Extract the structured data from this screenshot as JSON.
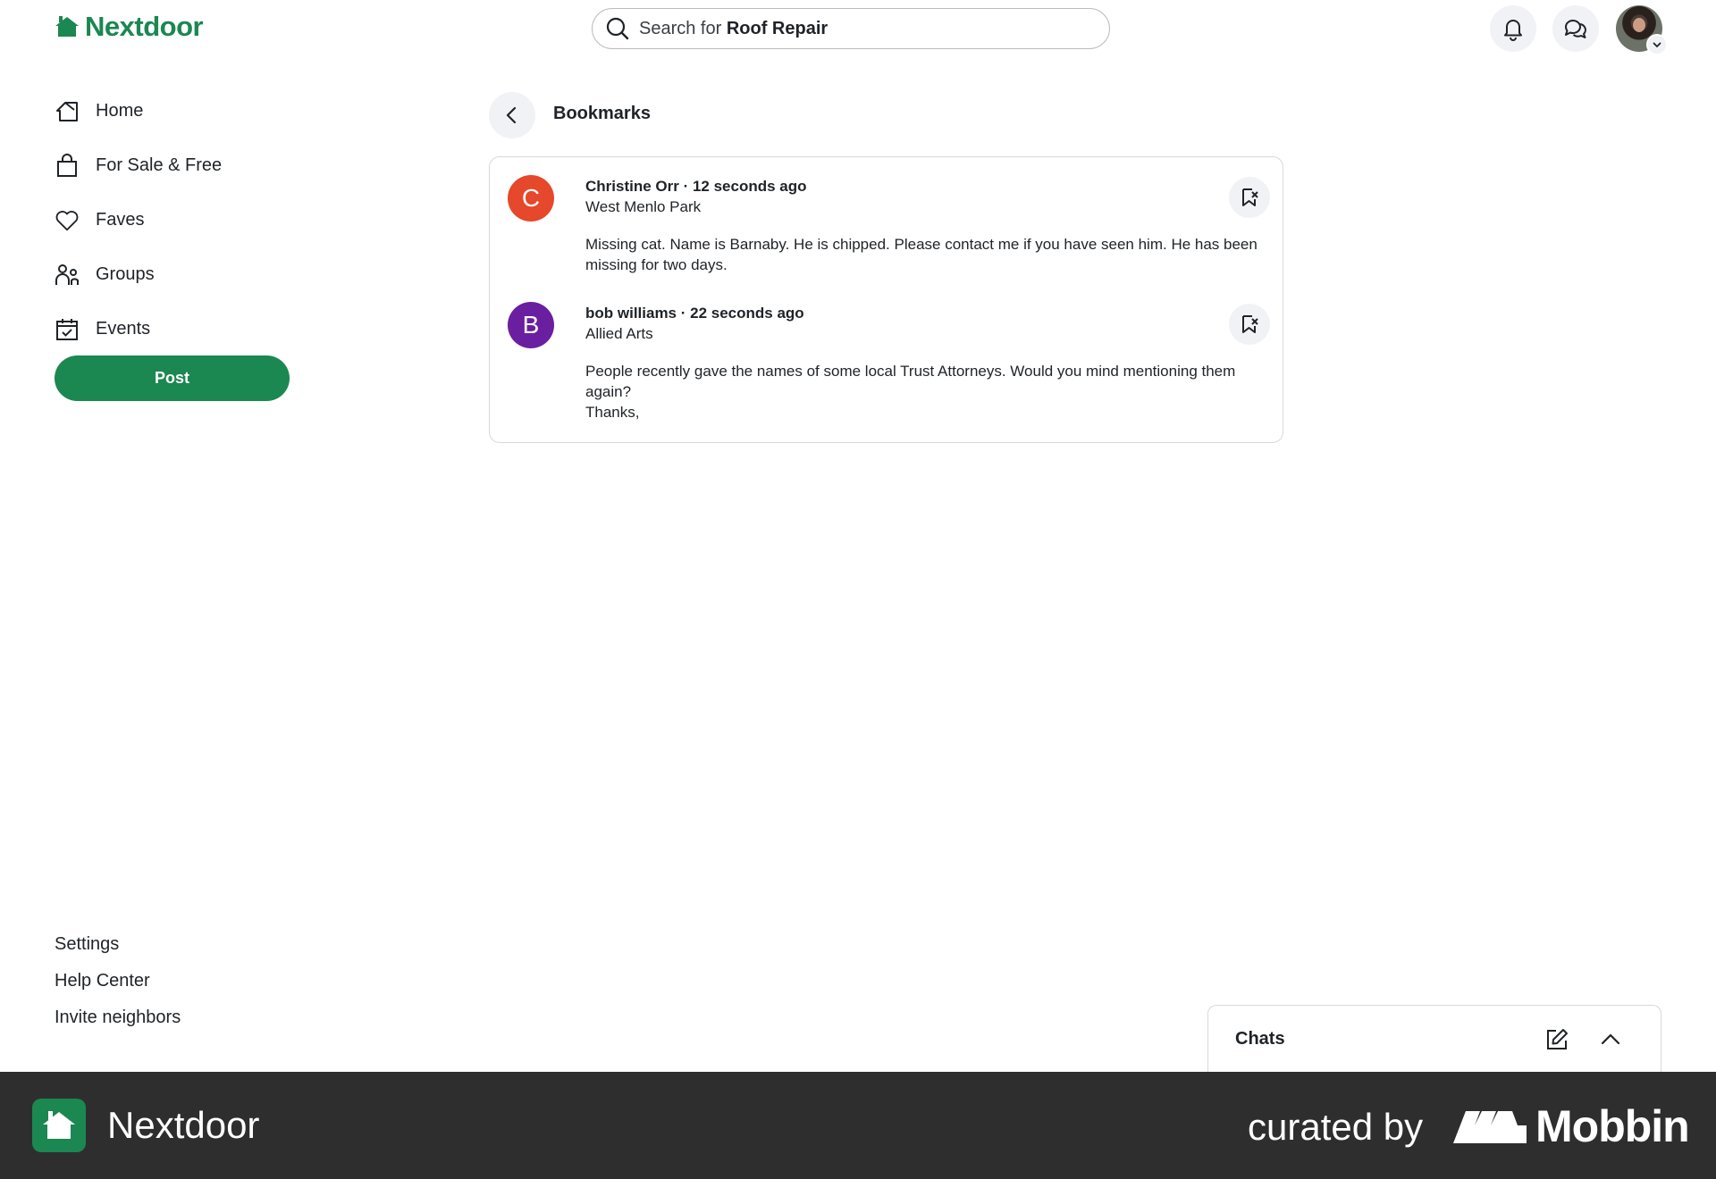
{
  "header": {
    "logo_text": "Nextdoor",
    "search_prefix": "Search for",
    "search_term": "Roof Repair"
  },
  "sidebar": {
    "items": [
      {
        "label": "Home",
        "icon": "home-icon"
      },
      {
        "label": "For Sale & Free",
        "icon": "shopping-bag-icon"
      },
      {
        "label": "Faves",
        "icon": "heart-icon"
      },
      {
        "label": "Groups",
        "icon": "groups-icon"
      },
      {
        "label": "Events",
        "icon": "calendar-check-icon"
      }
    ],
    "post_label": "Post",
    "footer_links": [
      "Settings",
      "Help Center",
      "Invite neighbors"
    ]
  },
  "main": {
    "title": "Bookmarks",
    "posts": [
      {
        "avatar_letter": "C",
        "avatar_color": "#e5482a",
        "author": "Christine Orr · 12 seconds ago",
        "neighborhood": "West Menlo Park",
        "body": "Missing cat. Name is Barnaby. He is chipped. Please contact me if you have seen him. He has been missing for two days."
      },
      {
        "avatar_letter": "B",
        "avatar_color": "#6a1fa0",
        "author": "bob williams · 22 seconds ago",
        "neighborhood": "Allied Arts",
        "body": "People recently gave the names of some local Trust Attorneys. Would you mind mentioning them again?\nThanks,"
      }
    ]
  },
  "chats": {
    "title": "Chats"
  },
  "banner": {
    "app_name": "Nextdoor",
    "curated_by": "curated by",
    "brand": "Mobbin"
  },
  "colors": {
    "brand_green": "#1b8751",
    "banner_bg": "#2e2e2e"
  }
}
